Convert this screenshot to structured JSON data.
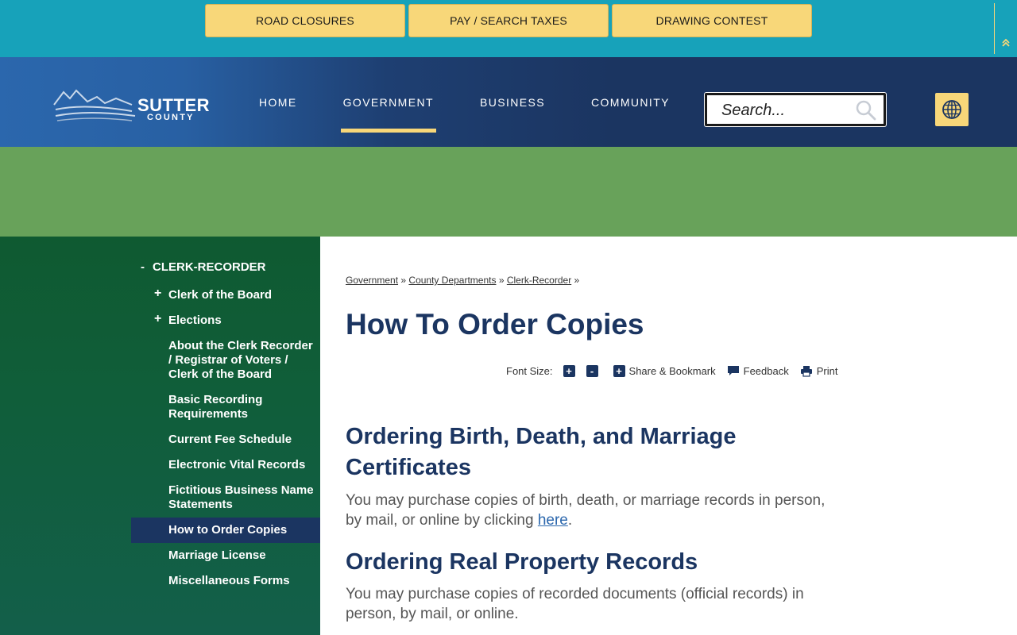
{
  "quick_links": [
    "ROAD CLOSURES",
    "PAY / SEARCH TAXES",
    "DRAWING CONTEST"
  ],
  "logo": {
    "name": "SUTTER",
    "subname": "COUNTY"
  },
  "nav": [
    {
      "label": "HOME",
      "active": false
    },
    {
      "label": "GOVERNMENT",
      "active": true
    },
    {
      "label": "BUSINESS",
      "active": false
    },
    {
      "label": "COMMUNITY",
      "active": false
    }
  ],
  "search": {
    "placeholder": "Search..."
  },
  "colors": {
    "accent": "#f8d779",
    "navy": "#1b3561",
    "teal": "#17a2ba",
    "banner_green": "#68a25a"
  },
  "sidebar": {
    "heading_toggle": "-",
    "heading": "CLERK-RECORDER",
    "items": [
      {
        "label": "Clerk of the Board",
        "expandable": true
      },
      {
        "label": "Elections",
        "expandable": true
      },
      {
        "label": "About the Clerk Recorder / Registrar of Voters / Clerk of the Board",
        "expandable": false
      },
      {
        "label": "Basic Recording Requirements",
        "expandable": false
      },
      {
        "label": "Current Fee Schedule",
        "expandable": false
      },
      {
        "label": "Electronic Vital Records",
        "expandable": false
      },
      {
        "label": "Fictitious Business Name Statements",
        "expandable": false
      },
      {
        "label": "How to Order Copies",
        "expandable": false,
        "active": true
      },
      {
        "label": "Marriage License",
        "expandable": false
      },
      {
        "label": "Miscellaneous Forms",
        "expandable": false
      }
    ]
  },
  "breadcrumb": {
    "items": [
      "Government",
      "County Departments",
      "Clerk-Recorder"
    ],
    "separator": "»"
  },
  "page_title": "How To Order Copies",
  "tools": {
    "font_size_label": "Font Size:",
    "increase": "+",
    "decrease": "-",
    "share_label": "Share & Bookmark",
    "feedback_label": "Feedback",
    "print_label": "Print"
  },
  "sections": [
    {
      "heading": "Ordering Birth, Death, and Marriage Certificates",
      "text": "You may purchase copies of birth, death, or marriage records in person, by mail, or online by clicking",
      "link": "here",
      "after_link": "."
    },
    {
      "heading": "Ordering Real Property Records",
      "text": "You may purchase copies of recorded documents (official records) in person, by mail, or online."
    }
  ]
}
